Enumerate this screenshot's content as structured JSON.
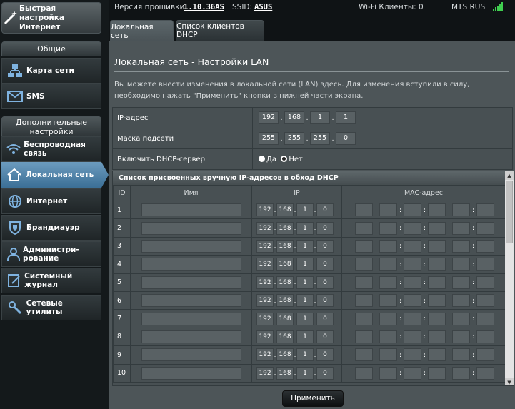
{
  "sidebar": {
    "quick_setup": "Быстрая настройка Интернет",
    "general_header": "Общие",
    "general_items": [
      {
        "label": "Карта сети",
        "icon": "network-map-icon"
      },
      {
        "label": "SMS",
        "icon": "envelope-icon"
      }
    ],
    "advanced_header": "Дополнительные настройки",
    "advanced_items": [
      {
        "label": "Беспроводная связь",
        "icon": "wifi-icon"
      },
      {
        "label": "Локальная сеть",
        "icon": "home-icon"
      },
      {
        "label": "Интернет",
        "icon": "globe-icon"
      },
      {
        "label": "Брандмауэр",
        "icon": "shield-icon"
      },
      {
        "label": "Администри-рование",
        "icon": "admin-user-icon"
      },
      {
        "label": "Системный журнал",
        "icon": "log-icon"
      },
      {
        "label": "Сетевые утилиты",
        "icon": "wrench-icon"
      }
    ],
    "active_item": "Локальная сеть"
  },
  "topbar": {
    "firmware_label": "Версия прошивки:",
    "firmware_value": "1.10.36AS",
    "ssid_label": "SSID:",
    "ssid_value": "ASUS",
    "wifi_clients": "Wi-Fi Клиенты: 0",
    "operator": "MTS RUS"
  },
  "tabs": [
    {
      "label": "Локальная сеть",
      "active": true
    },
    {
      "label": "Список клиентов DHCP",
      "active": false
    }
  ],
  "main": {
    "title": "Локальная сеть - Настройки LAN",
    "description": "Вы можете внести изменения в локальной сети (LAN) здесь. Для изменения вступили в силу, необходимо нажать \"Применить\" кнопки в нижней части экрана.",
    "ip_label": "IP-адрес",
    "ip_value": [
      "192",
      "168",
      "1",
      "1"
    ],
    "mask_label": "Маска подсети",
    "mask_value": [
      "255",
      "255",
      "255",
      "0"
    ],
    "dhcp_label": "Включить DHCP-сервер",
    "dhcp_yes": "Да",
    "dhcp_no": "Нет",
    "dhcp_selected": "Нет"
  },
  "dhcp_list": {
    "title": "Список присвоенных вручную IP-адресов в обход DHCP",
    "headers": {
      "id": "ID",
      "name": "Имя",
      "ip": "IP",
      "mac": "MAC-адрес"
    },
    "rows": [
      {
        "id": "1",
        "ip": [
          "192",
          "168",
          "1",
          "0"
        ]
      },
      {
        "id": "2",
        "ip": [
          "192",
          "168",
          "1",
          "0"
        ]
      },
      {
        "id": "3",
        "ip": [
          "192",
          "168",
          "1",
          "0"
        ]
      },
      {
        "id": "4",
        "ip": [
          "192",
          "168",
          "1",
          "0"
        ]
      },
      {
        "id": "5",
        "ip": [
          "192",
          "168",
          "1",
          "0"
        ]
      },
      {
        "id": "6",
        "ip": [
          "192",
          "168",
          "1",
          "0"
        ]
      },
      {
        "id": "7",
        "ip": [
          "192",
          "168",
          "1",
          "0"
        ]
      },
      {
        "id": "8",
        "ip": [
          "192",
          "168",
          "1",
          "0"
        ]
      },
      {
        "id": "9",
        "ip": [
          "192",
          "168",
          "1",
          "0"
        ]
      },
      {
        "id": "10",
        "ip": [
          "192",
          "168",
          "1",
          "0"
        ]
      }
    ]
  },
  "apply_label": "Применить"
}
